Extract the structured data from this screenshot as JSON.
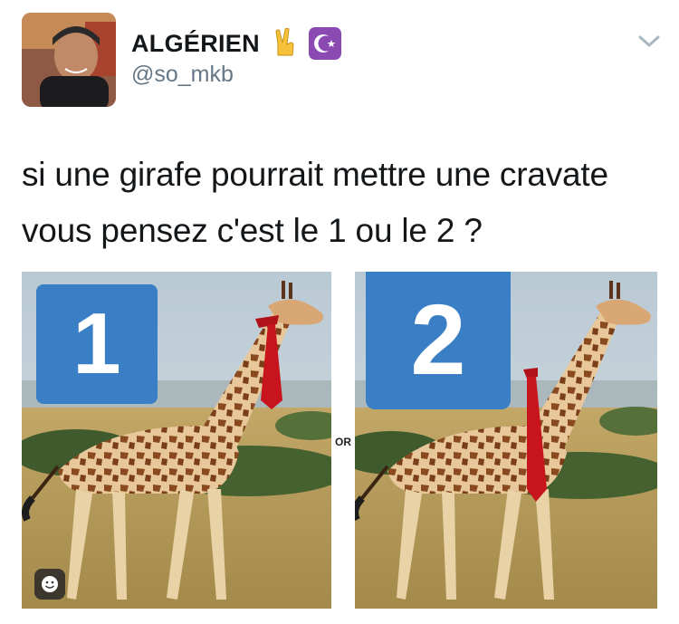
{
  "user": {
    "display_name": "ALGÉRIEN",
    "handle": "@so_mkb",
    "emojis": [
      "victory-hand-emoji",
      "star-and-crescent-emoji"
    ]
  },
  "tweet": {
    "text_lines": [
      "si une girafe pourrait mettre une cravate",
      "vous pensez c'est le 1 ou le 2 ?"
    ]
  },
  "media": {
    "left_number": "1",
    "right_number": "2",
    "separator": "OR",
    "colors": {
      "badge": "#3a7fc5",
      "tie": "#c8141c",
      "sky": "#c9d6de",
      "grass": "#b89a5a"
    }
  },
  "icons": {
    "chevron": "chevron-down-icon",
    "smiley": "smiley-icon"
  }
}
